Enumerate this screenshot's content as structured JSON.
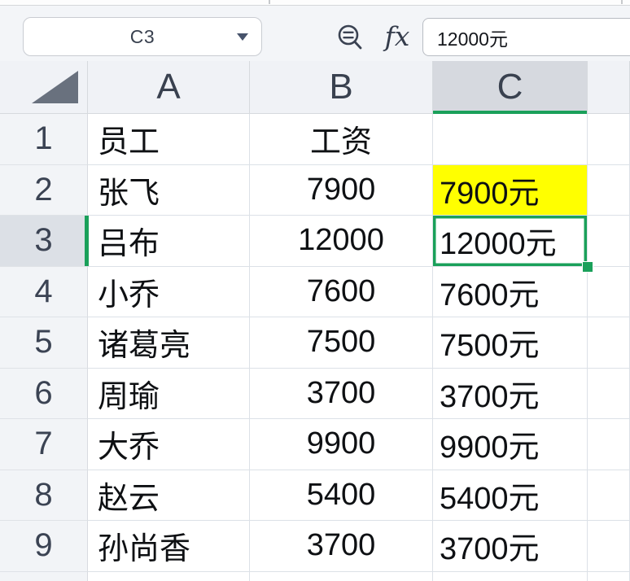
{
  "app": {
    "kind": "spreadsheet"
  },
  "name_box": {
    "value": "C3"
  },
  "formula_bar": {
    "fx_label": "fx",
    "value": "12000元"
  },
  "selection": {
    "cell": "C3",
    "column": "C",
    "row": "3"
  },
  "colors": {
    "accent_green": "#1aa05a",
    "highlight_yellow": "#ffff00",
    "selected_header_bg": "#d6d9df",
    "gridline": "#dce1e7",
    "header_text": "#39414f",
    "cell_text": "#0e1013"
  },
  "column_headers": {
    "a": "A",
    "b": "B",
    "c": "C",
    "d": ""
  },
  "sheet": {
    "rows": [
      {
        "n": "1",
        "a": "员工",
        "b": "工资",
        "c": ""
      },
      {
        "n": "2",
        "a": "张飞",
        "b": "7900",
        "c": "7900元"
      },
      {
        "n": "3",
        "a": "吕布",
        "b": "12000",
        "c": "12000元"
      },
      {
        "n": "4",
        "a": "小乔",
        "b": "7600",
        "c": "7600元"
      },
      {
        "n": "5",
        "a": "诸葛亮",
        "b": "7500",
        "c": "7500元"
      },
      {
        "n": "6",
        "a": "周瑜",
        "b": "3700",
        "c": "3700元"
      },
      {
        "n": "7",
        "a": "大乔",
        "b": "9900",
        "c": "9900元"
      },
      {
        "n": "8",
        "a": "赵云",
        "b": "5400",
        "c": "5400元"
      },
      {
        "n": "9",
        "a": "孙尚香",
        "b": "3700",
        "c": "3700元"
      }
    ]
  }
}
